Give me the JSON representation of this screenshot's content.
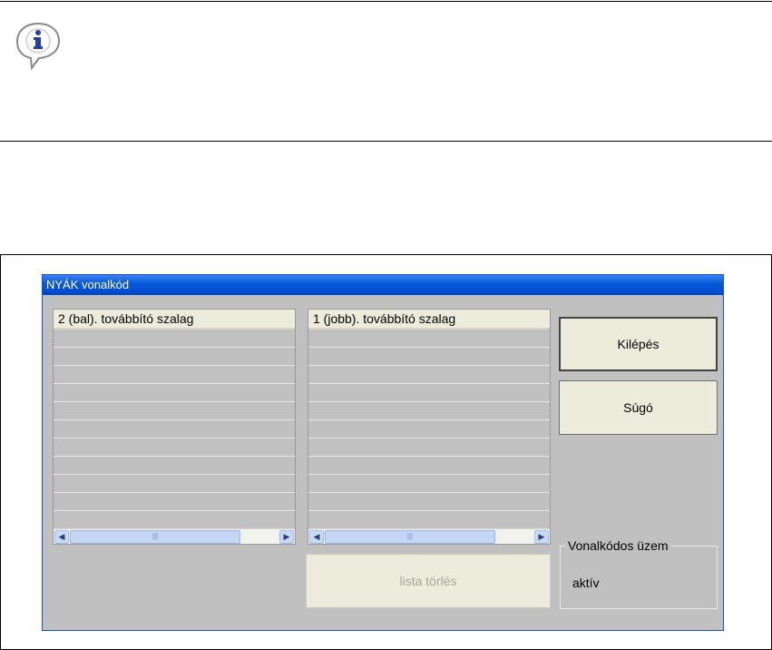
{
  "info_note": {
    "icon": "info-icon"
  },
  "window": {
    "title": "NYÁK vonalkód",
    "left_list": {
      "header": "2 (bal). továbbító szalag",
      "rows": [
        "",
        "",
        "",
        "",
        "",
        "",
        "",
        "",
        "",
        "",
        ""
      ]
    },
    "right_list": {
      "header": "1 (jobb). továbbító szalag",
      "rows": [
        "",
        "",
        "",
        "",
        "",
        "",
        "",
        "",
        "",
        "",
        ""
      ]
    },
    "buttons": {
      "exit": "Kilépés",
      "help": "Súgó",
      "clear_list": "lista törlés"
    },
    "barcode_mode": {
      "label": "Vonalkódos üzem",
      "value": "aktív"
    }
  }
}
